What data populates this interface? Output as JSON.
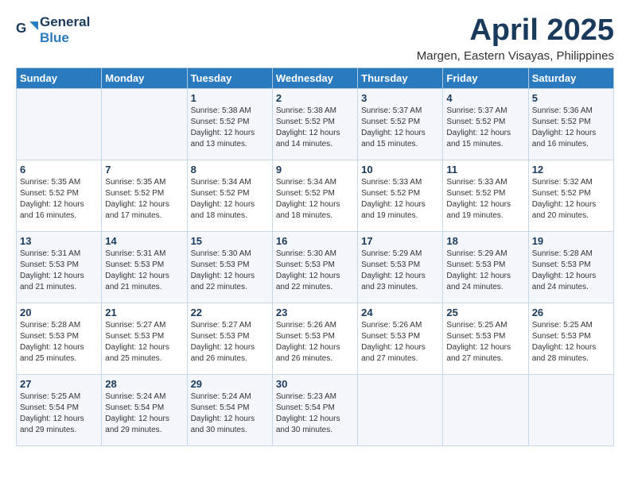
{
  "logo": {
    "line1": "General",
    "line2": "Blue"
  },
  "title": "April 2025",
  "subtitle": "Margen, Eastern Visayas, Philippines",
  "weekdays": [
    "Sunday",
    "Monday",
    "Tuesday",
    "Wednesday",
    "Thursday",
    "Friday",
    "Saturday"
  ],
  "weeks": [
    [
      {
        "day": "",
        "sunrise": "",
        "sunset": "",
        "daylight": ""
      },
      {
        "day": "",
        "sunrise": "",
        "sunset": "",
        "daylight": ""
      },
      {
        "day": "1",
        "sunrise": "Sunrise: 5:38 AM",
        "sunset": "Sunset: 5:52 PM",
        "daylight": "Daylight: 12 hours and 13 minutes."
      },
      {
        "day": "2",
        "sunrise": "Sunrise: 5:38 AM",
        "sunset": "Sunset: 5:52 PM",
        "daylight": "Daylight: 12 hours and 14 minutes."
      },
      {
        "day": "3",
        "sunrise": "Sunrise: 5:37 AM",
        "sunset": "Sunset: 5:52 PM",
        "daylight": "Daylight: 12 hours and 15 minutes."
      },
      {
        "day": "4",
        "sunrise": "Sunrise: 5:37 AM",
        "sunset": "Sunset: 5:52 PM",
        "daylight": "Daylight: 12 hours and 15 minutes."
      },
      {
        "day": "5",
        "sunrise": "Sunrise: 5:36 AM",
        "sunset": "Sunset: 5:52 PM",
        "daylight": "Daylight: 12 hours and 16 minutes."
      }
    ],
    [
      {
        "day": "6",
        "sunrise": "Sunrise: 5:35 AM",
        "sunset": "Sunset: 5:52 PM",
        "daylight": "Daylight: 12 hours and 16 minutes."
      },
      {
        "day": "7",
        "sunrise": "Sunrise: 5:35 AM",
        "sunset": "Sunset: 5:52 PM",
        "daylight": "Daylight: 12 hours and 17 minutes."
      },
      {
        "day": "8",
        "sunrise": "Sunrise: 5:34 AM",
        "sunset": "Sunset: 5:52 PM",
        "daylight": "Daylight: 12 hours and 18 minutes."
      },
      {
        "day": "9",
        "sunrise": "Sunrise: 5:34 AM",
        "sunset": "Sunset: 5:52 PM",
        "daylight": "Daylight: 12 hours and 18 minutes."
      },
      {
        "day": "10",
        "sunrise": "Sunrise: 5:33 AM",
        "sunset": "Sunset: 5:52 PM",
        "daylight": "Daylight: 12 hours and 19 minutes."
      },
      {
        "day": "11",
        "sunrise": "Sunrise: 5:33 AM",
        "sunset": "Sunset: 5:52 PM",
        "daylight": "Daylight: 12 hours and 19 minutes."
      },
      {
        "day": "12",
        "sunrise": "Sunrise: 5:32 AM",
        "sunset": "Sunset: 5:52 PM",
        "daylight": "Daylight: 12 hours and 20 minutes."
      }
    ],
    [
      {
        "day": "13",
        "sunrise": "Sunrise: 5:31 AM",
        "sunset": "Sunset: 5:53 PM",
        "daylight": "Daylight: 12 hours and 21 minutes."
      },
      {
        "day": "14",
        "sunrise": "Sunrise: 5:31 AM",
        "sunset": "Sunset: 5:53 PM",
        "daylight": "Daylight: 12 hours and 21 minutes."
      },
      {
        "day": "15",
        "sunrise": "Sunrise: 5:30 AM",
        "sunset": "Sunset: 5:53 PM",
        "daylight": "Daylight: 12 hours and 22 minutes."
      },
      {
        "day": "16",
        "sunrise": "Sunrise: 5:30 AM",
        "sunset": "Sunset: 5:53 PM",
        "daylight": "Daylight: 12 hours and 22 minutes."
      },
      {
        "day": "17",
        "sunrise": "Sunrise: 5:29 AM",
        "sunset": "Sunset: 5:53 PM",
        "daylight": "Daylight: 12 hours and 23 minutes."
      },
      {
        "day": "18",
        "sunrise": "Sunrise: 5:29 AM",
        "sunset": "Sunset: 5:53 PM",
        "daylight": "Daylight: 12 hours and 24 minutes."
      },
      {
        "day": "19",
        "sunrise": "Sunrise: 5:28 AM",
        "sunset": "Sunset: 5:53 PM",
        "daylight": "Daylight: 12 hours and 24 minutes."
      }
    ],
    [
      {
        "day": "20",
        "sunrise": "Sunrise: 5:28 AM",
        "sunset": "Sunset: 5:53 PM",
        "daylight": "Daylight: 12 hours and 25 minutes."
      },
      {
        "day": "21",
        "sunrise": "Sunrise: 5:27 AM",
        "sunset": "Sunset: 5:53 PM",
        "daylight": "Daylight: 12 hours and 25 minutes."
      },
      {
        "day": "22",
        "sunrise": "Sunrise: 5:27 AM",
        "sunset": "Sunset: 5:53 PM",
        "daylight": "Daylight: 12 hours and 26 minutes."
      },
      {
        "day": "23",
        "sunrise": "Sunrise: 5:26 AM",
        "sunset": "Sunset: 5:53 PM",
        "daylight": "Daylight: 12 hours and 26 minutes."
      },
      {
        "day": "24",
        "sunrise": "Sunrise: 5:26 AM",
        "sunset": "Sunset: 5:53 PM",
        "daylight": "Daylight: 12 hours and 27 minutes."
      },
      {
        "day": "25",
        "sunrise": "Sunrise: 5:25 AM",
        "sunset": "Sunset: 5:53 PM",
        "daylight": "Daylight: 12 hours and 27 minutes."
      },
      {
        "day": "26",
        "sunrise": "Sunrise: 5:25 AM",
        "sunset": "Sunset: 5:53 PM",
        "daylight": "Daylight: 12 hours and 28 minutes."
      }
    ],
    [
      {
        "day": "27",
        "sunrise": "Sunrise: 5:25 AM",
        "sunset": "Sunset: 5:54 PM",
        "daylight": "Daylight: 12 hours and 29 minutes."
      },
      {
        "day": "28",
        "sunrise": "Sunrise: 5:24 AM",
        "sunset": "Sunset: 5:54 PM",
        "daylight": "Daylight: 12 hours and 29 minutes."
      },
      {
        "day": "29",
        "sunrise": "Sunrise: 5:24 AM",
        "sunset": "Sunset: 5:54 PM",
        "daylight": "Daylight: 12 hours and 30 minutes."
      },
      {
        "day": "30",
        "sunrise": "Sunrise: 5:23 AM",
        "sunset": "Sunset: 5:54 PM",
        "daylight": "Daylight: 12 hours and 30 minutes."
      },
      {
        "day": "",
        "sunrise": "",
        "sunset": "",
        "daylight": ""
      },
      {
        "day": "",
        "sunrise": "",
        "sunset": "",
        "daylight": ""
      },
      {
        "day": "",
        "sunrise": "",
        "sunset": "",
        "daylight": ""
      }
    ]
  ]
}
